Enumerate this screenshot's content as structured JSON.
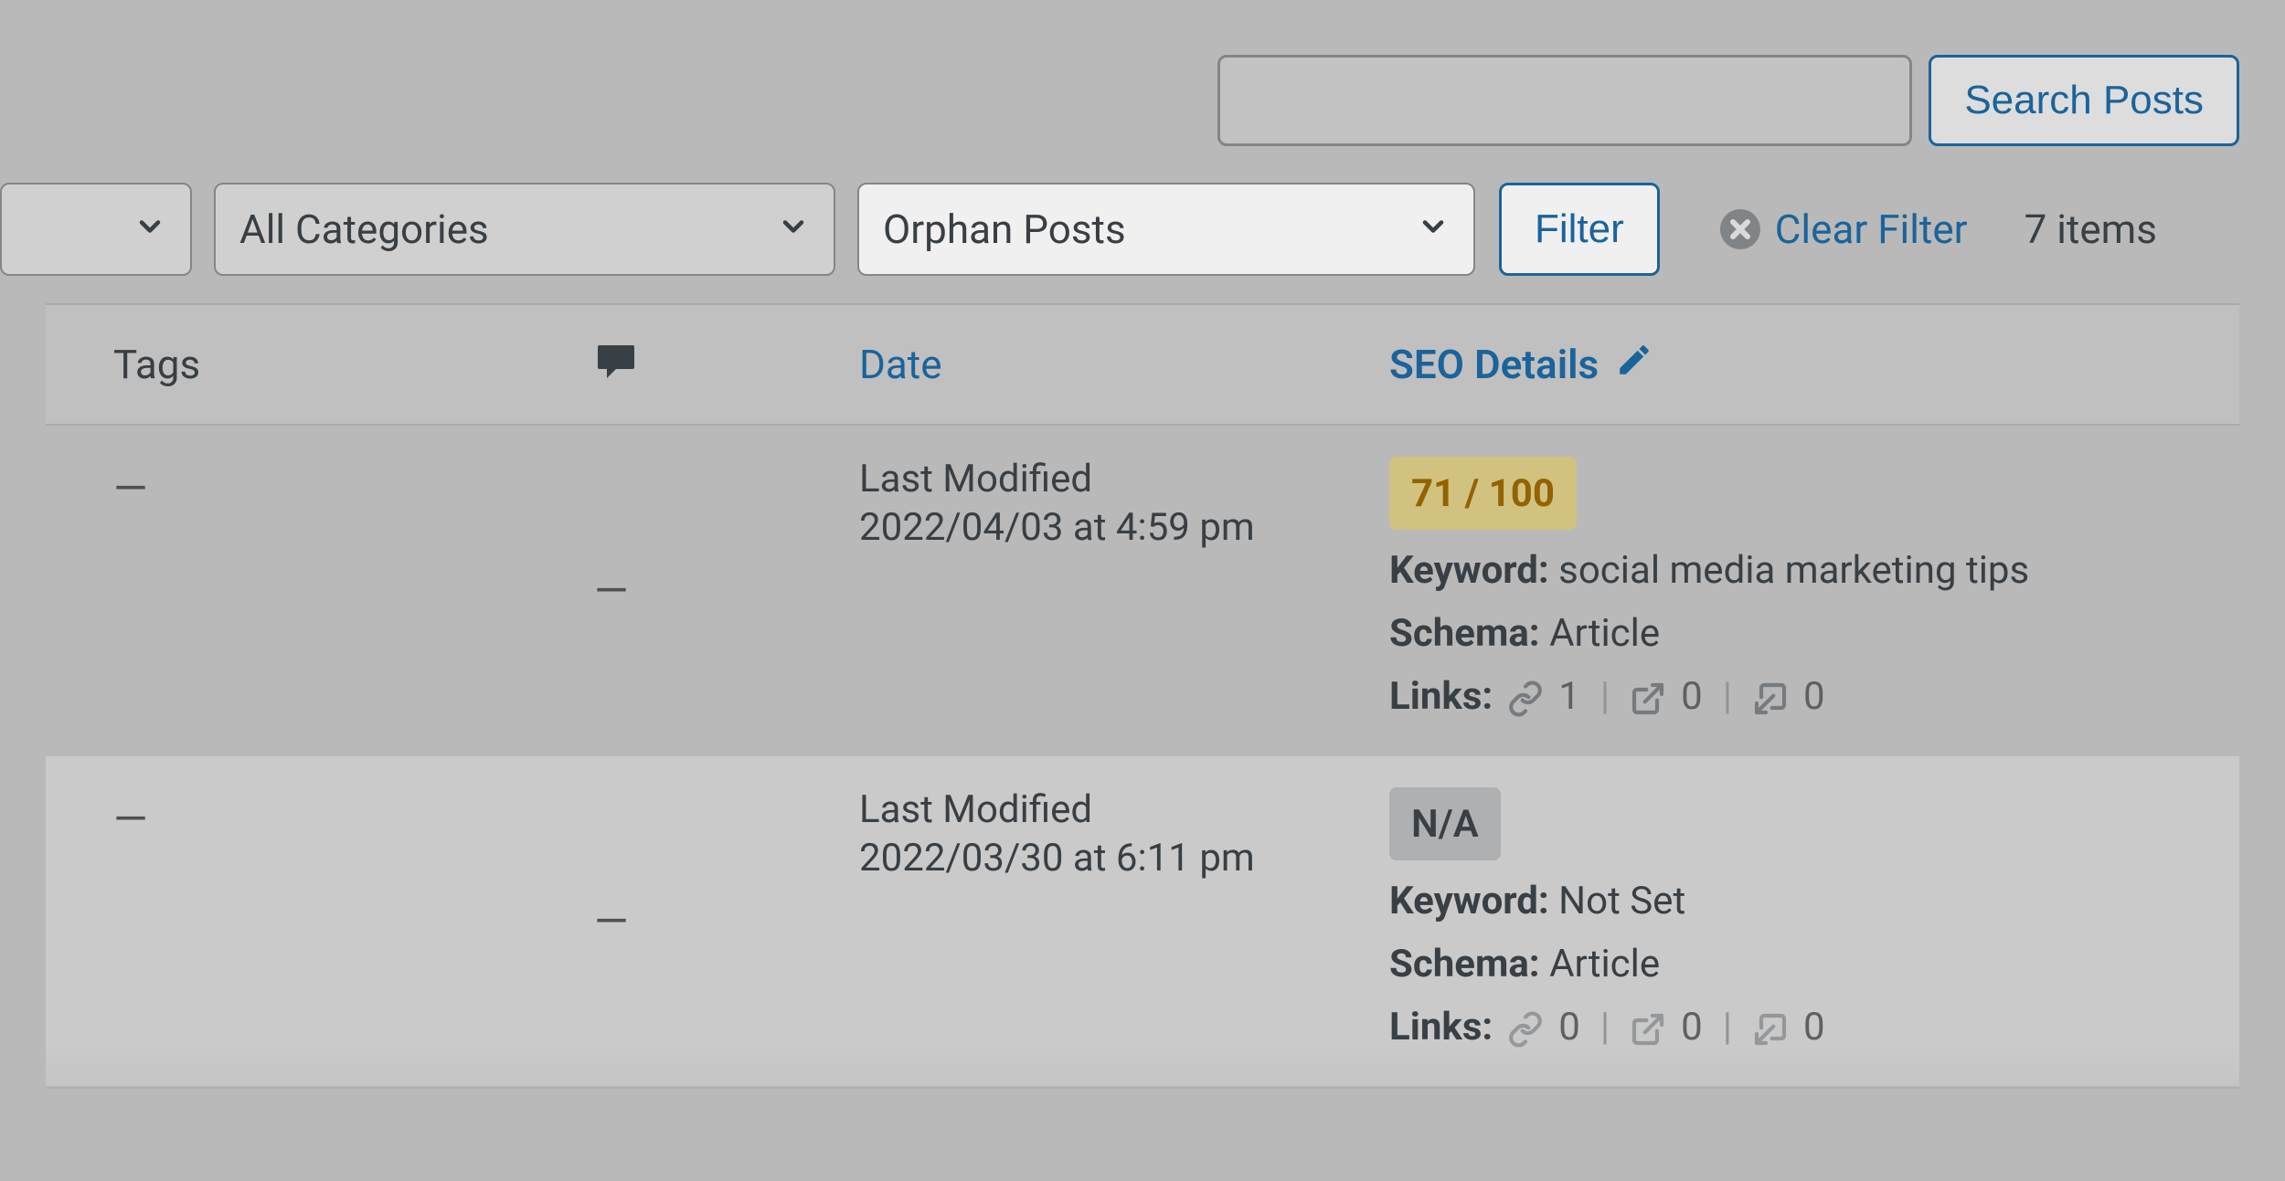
{
  "search": {
    "input_value": "",
    "button_label": "Search Posts"
  },
  "filters": {
    "select1": "",
    "select2": "All Categories",
    "select3": "Orphan Posts",
    "filter_button": "Filter",
    "clear_filter": "Clear Filter",
    "items_count": "7 items"
  },
  "table": {
    "headers": {
      "tags": "Tags",
      "date": "Date",
      "seo_details": "SEO Details"
    },
    "rows": [
      {
        "tags": "—",
        "comments": "—",
        "date_label": "Last Modified",
        "date_value": "2022/04/03 at 4:59 pm",
        "seo": {
          "score_text": "71 / 100",
          "score_class": "warn",
          "keyword_label": "Keyword:",
          "keyword_value": "social media marketing tips",
          "schema_label": "Schema:",
          "schema_value": "Article",
          "links_label": "Links:",
          "links_internal": "1",
          "links_external": "0",
          "links_incoming": "0"
        }
      },
      {
        "tags": "—",
        "comments": "—",
        "date_label": "Last Modified",
        "date_value": "2022/03/30 at 6:11 pm",
        "seo": {
          "score_text": "N/A",
          "score_class": "na",
          "keyword_label": "Keyword:",
          "keyword_value": "Not Set",
          "schema_label": "Schema:",
          "schema_value": "Article",
          "links_label": "Links:",
          "links_internal": "0",
          "links_external": "0",
          "links_incoming": "0"
        }
      }
    ]
  }
}
